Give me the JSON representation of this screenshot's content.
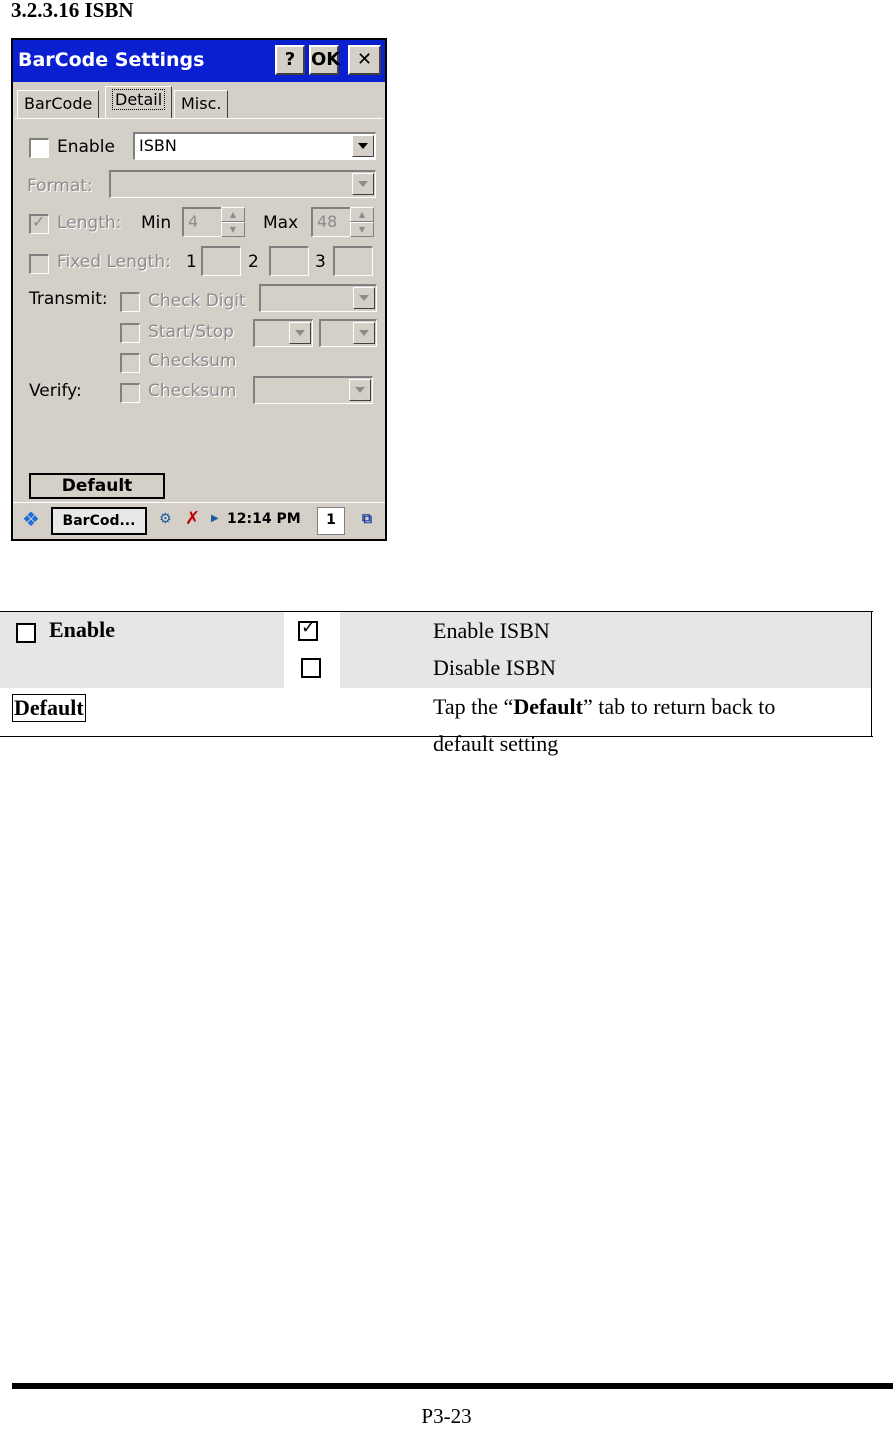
{
  "heading": "3.2.3.16 ISBN",
  "device": {
    "window_title": "BarCode Settings",
    "title_buttons": {
      "help": "?",
      "ok": "OK",
      "close": "✕"
    },
    "tabs": [
      "BarCode",
      "Detail",
      "Misc."
    ],
    "active_tab": "Detail",
    "enable": {
      "label": "Enable",
      "checked": false,
      "value": "ISBN"
    },
    "format": {
      "label": "Format:",
      "value": ""
    },
    "length": {
      "label": "Length:",
      "checked": true,
      "min_label": "Min",
      "min_value": "4",
      "max_label": "Max",
      "max_value": "48"
    },
    "fixed_length": {
      "label": "Fixed Length:",
      "checked": false,
      "fields": [
        "1",
        "2",
        "3"
      ]
    },
    "transmit": {
      "label": "Transmit:",
      "check_digit": "Check Digit",
      "start_stop": "Start/Stop",
      "checksum": "Checksum"
    },
    "verify": {
      "label": "Verify:",
      "checksum": "Checksum"
    },
    "default_button": "Default",
    "taskbar": {
      "task": "BarCod...",
      "time": "12:14 PM",
      "input": "1"
    }
  },
  "table": {
    "enable_label": "Enable",
    "rows": [
      {
        "state": "checked",
        "description": "Enable ISBN"
      },
      {
        "state": "unchecked",
        "description": "Disable ISBN"
      }
    ],
    "default_label": "Default",
    "default_desc_pre": "Tap the “",
    "default_desc_bold": "Default",
    "default_desc_post": "” tab to return back to",
    "default_desc_line2": "default setting"
  },
  "footer": {
    "page": "P3-23"
  }
}
